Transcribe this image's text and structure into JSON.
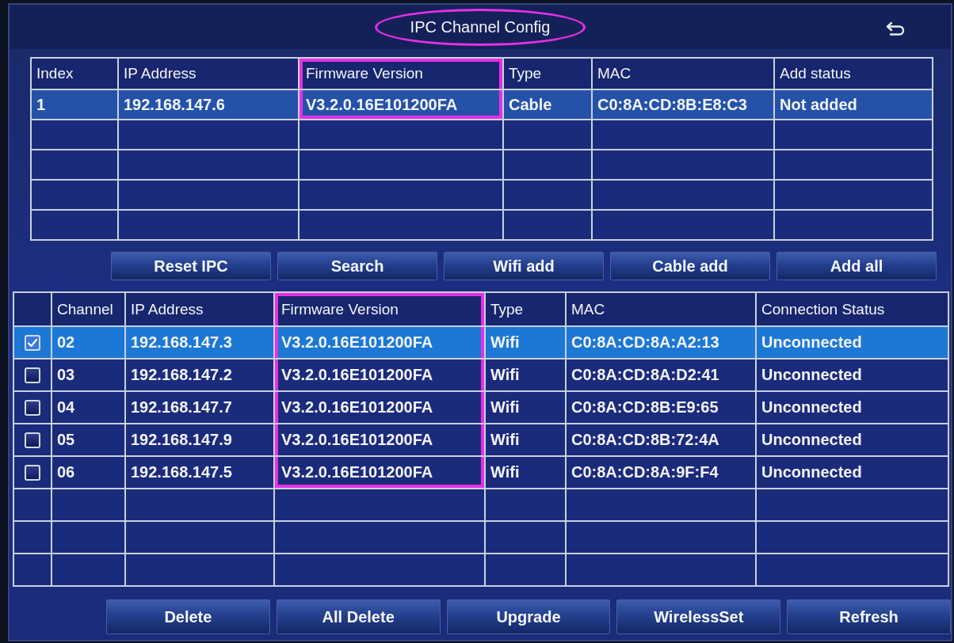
{
  "window": {
    "title": "IPC Channel Config",
    "title_highlighted": true
  },
  "discovered_table": {
    "columns": [
      {
        "label": "Index",
        "highlighted": false
      },
      {
        "label": "IP Address",
        "highlighted": false
      },
      {
        "label": "Firmware Version",
        "highlighted": true
      },
      {
        "label": "Type",
        "highlighted": false
      },
      {
        "label": "MAC",
        "highlighted": false
      },
      {
        "label": "Add status",
        "highlighted": false
      }
    ],
    "rows": [
      {
        "selected": true,
        "cells": [
          "1",
          "192.168.147.6",
          "V3.2.0.16E101200FA",
          "Cable",
          "C0:8A:CD:8B:E8:C3",
          "Not added"
        ]
      }
    ]
  },
  "action_buttons": [
    "Reset IPC",
    "Search",
    "Wifi add",
    "Cable add",
    "Add all"
  ],
  "channel_table": {
    "columns": [
      {
        "label": "Channel",
        "highlighted": false
      },
      {
        "label": "IP Address",
        "highlighted": false
      },
      {
        "label": "Firmware Version",
        "highlighted": true
      },
      {
        "label": "Type",
        "highlighted": false
      },
      {
        "label": "MAC",
        "highlighted": false
      },
      {
        "label": "Connection Status",
        "highlighted": false
      }
    ],
    "rows": [
      {
        "selected": true,
        "checked": true,
        "cells": [
          "02",
          "192.168.147.3",
          "V3.2.0.16E101200FA",
          "Wifi",
          "C0:8A:CD:8A:A2:13",
          "Unconnected"
        ]
      },
      {
        "selected": false,
        "checked": false,
        "cells": [
          "03",
          "192.168.147.2",
          "V3.2.0.16E101200FA",
          "Wifi",
          "C0:8A:CD:8A:D2:41",
          "Unconnected"
        ]
      },
      {
        "selected": false,
        "checked": false,
        "cells": [
          "04",
          "192.168.147.7",
          "V3.2.0.16E101200FA",
          "Wifi",
          "C0:8A:CD:8B:E9:65",
          "Unconnected"
        ]
      },
      {
        "selected": false,
        "checked": false,
        "cells": [
          "05",
          "192.168.147.9",
          "V3.2.0.16E101200FA",
          "Wifi",
          "C0:8A:CD:8B:72:4A",
          "Unconnected"
        ]
      },
      {
        "selected": false,
        "checked": false,
        "cells": [
          "06",
          "192.168.147.5",
          "V3.2.0.16E101200FA",
          "Wifi",
          "C0:8A:CD:8A:9F:F4",
          "Unconnected"
        ]
      }
    ]
  },
  "bottom_buttons": [
    "Delete",
    "All Delete",
    "Upgrade",
    "WirelessSet",
    "Refresh"
  ]
}
